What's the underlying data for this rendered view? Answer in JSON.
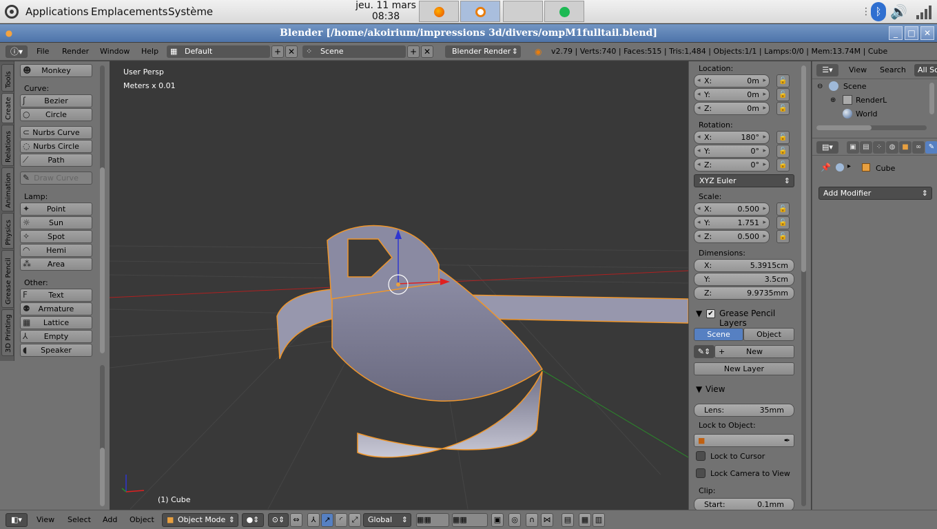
{
  "gnome": {
    "menus": [
      "Applications",
      "Emplacements",
      "Système"
    ],
    "clock_date": "jeu. 11 mars",
    "clock_time": "08:38"
  },
  "window": {
    "title": "Blender [/home/akoirium/impressions 3d/divers/ompM1fulltail.blend]"
  },
  "info_header": {
    "menus": [
      "File",
      "Render",
      "Window",
      "Help"
    ],
    "layout": "Default",
    "scene": "Scene",
    "engine": "Blender Render",
    "stats": "v2.79 | Verts:740 | Faces:515 | Tris:1,484 | Objects:1/1 | Lamps:0/0 | Mem:13.74M | Cube"
  },
  "tool_tabs": [
    "Tools",
    "Create",
    "Relations",
    "Animation",
    "Physics",
    "Grease Pencil",
    "3D Printing"
  ],
  "tool_shelf": {
    "monkey": "Monkey",
    "curve_label": "Curve:",
    "bezier": "Bezier",
    "circle": "Circle",
    "nurbs_curve": "Nurbs Curve",
    "nurbs_circle": "Nurbs Circle",
    "path": "Path",
    "draw_curve": "Draw Curve",
    "lamp_label": "Lamp:",
    "point": "Point",
    "sun": "Sun",
    "spot": "Spot",
    "hemi": "Hemi",
    "area": "Area",
    "other_label": "Other:",
    "text": "Text",
    "armature": "Armature",
    "lattice": "Lattice",
    "empty": "Empty",
    "speaker": "Speaker"
  },
  "viewport": {
    "view_name": "User Persp",
    "units": "Meters x 0.01",
    "object_label": "(1) Cube"
  },
  "n_panel": {
    "location_label": "Location:",
    "location": {
      "x": "0m",
      "y": "0m",
      "z": "0m"
    },
    "rotation_label": "Rotation:",
    "rotation": {
      "x": "180°",
      "y": "0°",
      "z": "0°"
    },
    "rotation_mode": "XYZ Euler",
    "scale_label": "Scale:",
    "scale": {
      "x": "0.500",
      "y": "1.751",
      "z": "0.500"
    },
    "dimensions_label": "Dimensions:",
    "dimensions": {
      "x": "5.3915cm",
      "y": "3.5cm",
      "z": "9.9735mm"
    },
    "gp_layers": "Grease Pencil Layers",
    "gp_scene": "Scene",
    "gp_object": "Object",
    "gp_new": "New",
    "gp_new_layer": "New Layer",
    "view_section": "View",
    "lens_label": "Lens:",
    "lens_value": "35mm",
    "lock_to_object": "Lock to Object:",
    "lock_to_cursor": "Lock to Cursor",
    "lock_camera": "Lock Camera to View",
    "clip_label": "Clip:",
    "clip_start_label": "Start:",
    "clip_start_value": "0.1mm",
    "axis_labels": {
      "x": "X:",
      "y": "Y:",
      "z": "Z:"
    }
  },
  "outliner": {
    "view": "View",
    "search": "Search",
    "all_scenes": "All Sc",
    "scene": "Scene",
    "render_layers": "RenderL",
    "world": "World"
  },
  "properties": {
    "object": "Cube",
    "add_modifier": "Add Modifier"
  },
  "view3d_header": {
    "view": "View",
    "select": "Select",
    "add": "Add",
    "object": "Object",
    "mode": "Object Mode",
    "orientation": "Global"
  }
}
